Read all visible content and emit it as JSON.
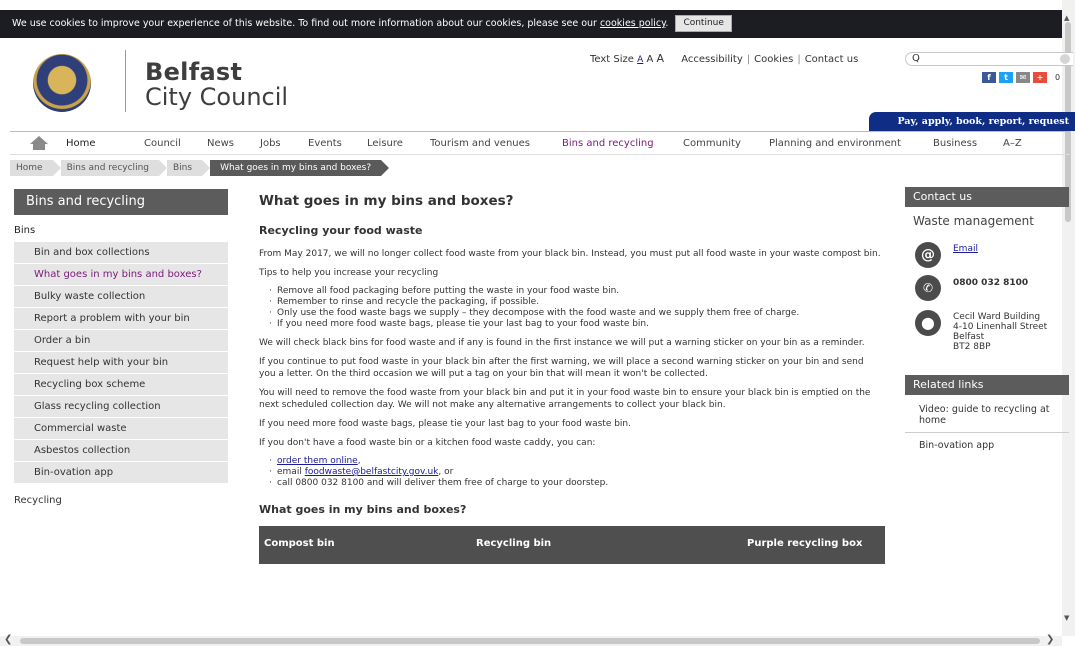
{
  "cookie": {
    "message": "We use cookies to improve your experience of this website. To find out more information about our cookies, please see our ",
    "link": "cookies policy",
    "after": ".",
    "button": "Continue"
  },
  "logo": {
    "line1": "Belfast",
    "line2": "City Council",
    "crest": "belfast-city-council-crest"
  },
  "utility": {
    "text_size_label": "Text Size",
    "size_small": "A",
    "size_medium": "A",
    "size_large": "A",
    "accessibility": "Accessibility",
    "cookies": "Cookies",
    "contact": "Contact us"
  },
  "search": {
    "placeholder": "Q"
  },
  "social": {
    "facebook": "f",
    "twitter": "t",
    "email": "✉",
    "share": "+",
    "count": "0",
    "colors": {
      "facebook": "#3b5998",
      "twitter": "#1da1f2",
      "email": "#888888",
      "share": "#e84c3d"
    }
  },
  "pay_bar": "Pay, apply, book, report, request",
  "nav": {
    "home": "Home",
    "council": "Council",
    "news": "News",
    "jobs": "Jobs",
    "events": "Events",
    "leisure": "Leisure",
    "tourism": "Tourism and venues",
    "bins": "Bins and recycling",
    "community": "Community",
    "planning": "Planning and environment",
    "business": "Business",
    "az": "A–Z"
  },
  "breadcrumb": [
    "Home",
    "Bins and recycling",
    "Bins",
    "What goes in my bins and boxes?"
  ],
  "sidebar": {
    "title": "Bins and recycling",
    "group": "Bins",
    "items": [
      "Bin and box collections",
      "What goes in my bins and boxes?",
      "Bulky waste collection",
      "Report a problem with your bin",
      "Order a bin",
      "Request help with your bin",
      "Recycling box scheme",
      "Glass recycling collection",
      "Commercial waste",
      "Asbestos collection",
      "Bin-ovation app"
    ],
    "footer_group": "Recycling"
  },
  "content": {
    "title": "What goes in my bins and boxes?",
    "section": "Recycling your food waste",
    "p1": "From May 2017, we will no longer collect food waste from your black bin. Instead, you must put all food waste in your waste compost bin.",
    "p2": "Tips to help you increase your recycling",
    "tips": [
      "Remove all food packaging before putting the waste in your food waste bin.",
      "Remember to rinse and recycle the packaging, if possible.",
      "Only use the food waste bags we supply – they decompose with the food waste and we supply them free of charge.",
      "If you need more food waste bags, please tie your last bag to your food waste bin."
    ],
    "p3": "We will check black bins for food waste and if any is found in the first instance we will put a warning sticker on your bin as a reminder.",
    "p4": "If you continue to put food waste in your black bin after the first warning, we will place a second warning sticker on your bin and send you a letter. On the third occasion we will put a tag on your bin that will mean it won't be collected.",
    "p5": "You will need to remove the food waste from your black bin and put it in your food waste bin to ensure your black bin is emptied on the next scheduled collection day. We will not make any alternative arrangements to collect your black bin.",
    "p6": "If you need more food waste bags, please tie your last bag to your food waste bin.",
    "p7": "If you don't have a food waste bin or a kitchen food waste caddy, you can:",
    "order_link": "order them online",
    "order_after": ",",
    "email_prefix": "email ",
    "email_link": "foodwaste@belfastcity.gov.uk",
    "email_after": ", or",
    "call": "call 0800 032 8100 and will deliver them free of charge to your doorstep.",
    "subhead": "What goes in my bins and boxes?",
    "table_headers": [
      "Compost bin",
      "Recycling bin",
      "Purple recycling box"
    ]
  },
  "contact": {
    "title": "Contact us",
    "dept": "Waste management",
    "email": "Email",
    "phone": "0800 032 8100",
    "address": [
      "Cecil Ward Building",
      "4-10 Linenhall Street",
      "Belfast",
      "BT2 8BP"
    ]
  },
  "related": {
    "title": "Related links",
    "items": [
      "Video: guide to recycling at home",
      "Bin-ovation app"
    ]
  }
}
